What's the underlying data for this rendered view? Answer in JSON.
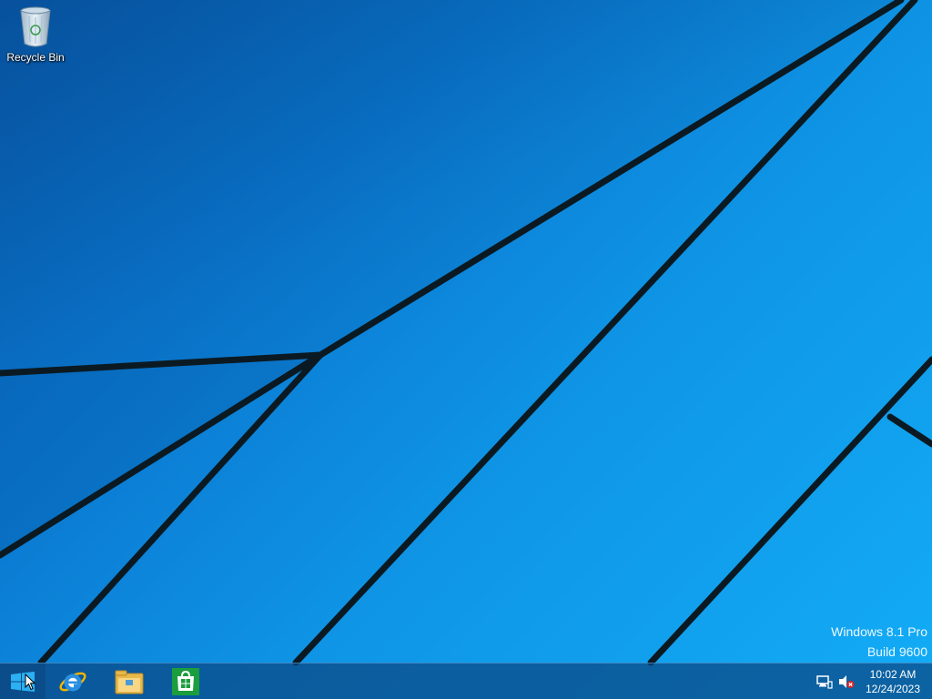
{
  "desktop": {
    "icons": [
      {
        "label": "Recycle Bin",
        "icon": "recycle-bin-icon"
      }
    ],
    "background_colors": {
      "dark": "#0a63b8",
      "light": "#13acf6",
      "lines": "#0b1a22"
    }
  },
  "watermark": {
    "line1": "Windows 8.1 Pro",
    "line2": "Build 9600"
  },
  "taskbar": {
    "start_icon": "windows-logo-icon",
    "pinned": [
      {
        "app": "internet-explorer",
        "icon": "internet-explorer-icon"
      },
      {
        "app": "file-explorer",
        "icon": "file-explorer-icon"
      },
      {
        "app": "store",
        "icon": "windows-store-icon"
      }
    ],
    "tray": {
      "network_icon": "network-icon",
      "volume_icon": "volume-muted-icon"
    },
    "clock": {
      "time": "10:02 AM",
      "date": "12/24/2023"
    }
  }
}
